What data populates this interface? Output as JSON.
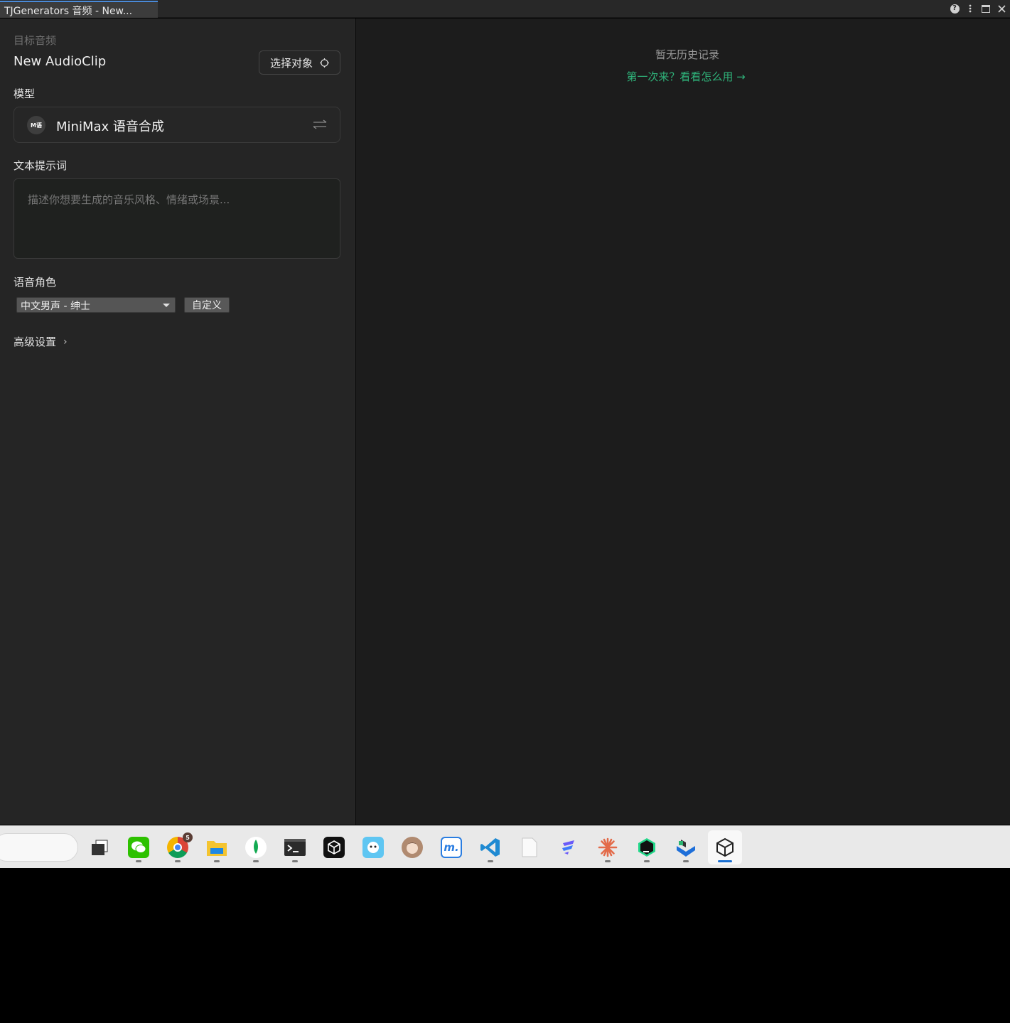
{
  "window": {
    "tab_title": "TJGenerators 音频 - New..."
  },
  "left": {
    "target_label": "目标音频",
    "target_value": "New AudioClip",
    "select_button": "选择对象",
    "model_label": "模型",
    "model_logo_text": "M语",
    "model_name": "MiniMax 语音合成",
    "prompt_label": "文本提示词",
    "prompt_placeholder": "描述你想要生成的音乐风格、情绪或场景...",
    "voice_label": "语音角色",
    "voice_selected": "中文男声 - 绅士",
    "custom_button": "自定义",
    "advanced_label": "高级设置",
    "advanced_chevron": "›"
  },
  "right": {
    "no_history": "暂无历史记录",
    "first_time_link": "第一次来？看看怎么用 →"
  },
  "taskbar": {
    "chrome_badge": "5",
    "apps": [
      "task-view",
      "wechat",
      "chrome",
      "file-explorer",
      "mongodb-compass",
      "terminal",
      "unity-hub",
      "qq",
      "anime-avatar-app",
      "maven-app",
      "vscode",
      "notepad",
      "feishu",
      "claude",
      "clion",
      "unity-tool",
      "unity-editor"
    ]
  },
  "colors": {
    "accent_link": "#2fb37a",
    "tab_accent": "#4a8ad8",
    "taskbar_active": "#1a6fd1"
  }
}
